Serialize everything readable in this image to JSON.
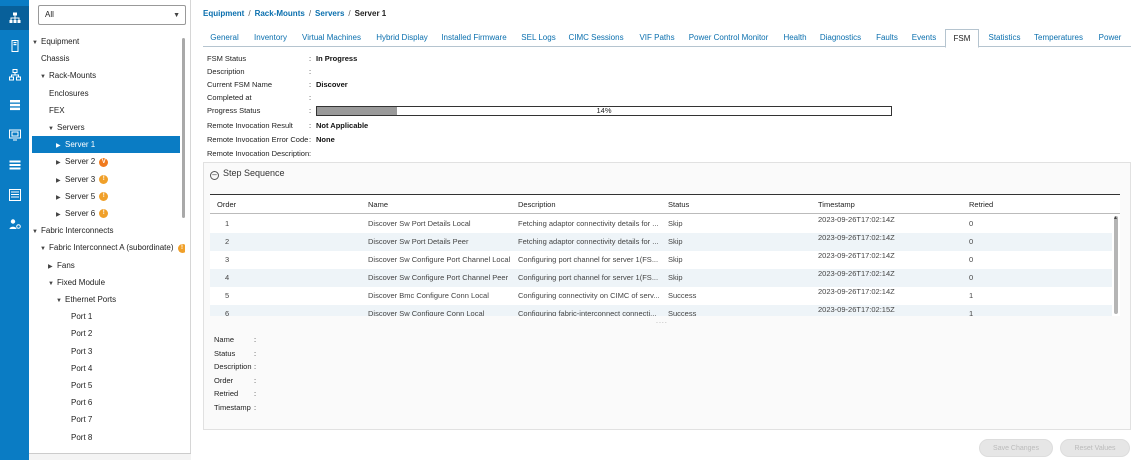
{
  "rail": {
    "items": [
      {
        "icon": "network-topology-icon",
        "active": true
      },
      {
        "icon": "server-icon",
        "active": false
      },
      {
        "icon": "lan-icon",
        "active": false
      },
      {
        "icon": "san-storage-icon",
        "active": false
      },
      {
        "icon": "vm-icon",
        "active": false
      },
      {
        "icon": "storage-stack-icon",
        "active": false
      },
      {
        "icon": "admin-list-icon",
        "active": false
      },
      {
        "icon": "user-settings-icon",
        "active": false
      }
    ]
  },
  "nav": {
    "filter_value": "All",
    "tree": [
      {
        "label": "Equipment",
        "depth": 0,
        "expander": "down"
      },
      {
        "label": "Chassis",
        "depth": 1,
        "expander": "none"
      },
      {
        "label": "Rack-Mounts",
        "depth": 1,
        "expander": "down"
      },
      {
        "label": "Enclosures",
        "depth": 2,
        "expander": "none"
      },
      {
        "label": "FEX",
        "depth": 2,
        "expander": "none"
      },
      {
        "label": "Servers",
        "depth": 2,
        "expander": "down"
      },
      {
        "label": "Server 1",
        "depth": 3,
        "expander": "right",
        "selected": true
      },
      {
        "label": "Server 2",
        "depth": 3,
        "expander": "right",
        "badge": "V",
        "badge_kind": "major"
      },
      {
        "label": "Server 3",
        "depth": 3,
        "expander": "right",
        "badge": "!",
        "badge_kind": "minor"
      },
      {
        "label": "Server 5",
        "depth": 3,
        "expander": "right",
        "badge": "!",
        "badge_kind": "minor"
      },
      {
        "label": "Server 6",
        "depth": 3,
        "expander": "right",
        "badge": "!",
        "badge_kind": "minor"
      },
      {
        "label": "Fabric Interconnects",
        "depth": 0,
        "expander": "down"
      },
      {
        "label": "Fabric Interconnect A (subordinate)",
        "depth": 1,
        "expander": "down",
        "badge": "!",
        "badge_kind": "minor"
      },
      {
        "label": "Fans",
        "depth": 2,
        "expander": "right"
      },
      {
        "label": "Fixed Module",
        "depth": 2,
        "expander": "down"
      },
      {
        "label": "Ethernet Ports",
        "depth": 3,
        "expander": "down"
      },
      {
        "label": "Port 1",
        "depth": 4,
        "expander": "none"
      },
      {
        "label": "Port 2",
        "depth": 4,
        "expander": "none"
      },
      {
        "label": "Port 3",
        "depth": 4,
        "expander": "none"
      },
      {
        "label": "Port 4",
        "depth": 4,
        "expander": "none"
      },
      {
        "label": "Port 5",
        "depth": 4,
        "expander": "none"
      },
      {
        "label": "Port 6",
        "depth": 4,
        "expander": "none"
      },
      {
        "label": "Port 7",
        "depth": 4,
        "expander": "none"
      },
      {
        "label": "Port 8",
        "depth": 4,
        "expander": "none"
      }
    ]
  },
  "breadcrumb": {
    "items": [
      "Equipment",
      "Rack-Mounts",
      "Servers"
    ],
    "current": "Server 1"
  },
  "tabs": [
    {
      "label": "General"
    },
    {
      "label": "Inventory"
    },
    {
      "label": "Virtual Machines"
    },
    {
      "label": "Hybrid Display"
    },
    {
      "label": "Installed Firmware"
    },
    {
      "label": "SEL Logs"
    },
    {
      "label": "CIMC Sessions"
    },
    {
      "label": "VIF Paths"
    },
    {
      "label": "Power Control Monitor"
    },
    {
      "label": "Health"
    },
    {
      "label": "Diagnostics"
    },
    {
      "label": "Faults"
    },
    {
      "label": "Events"
    },
    {
      "label": "FSM",
      "active": true
    },
    {
      "label": "Statistics"
    },
    {
      "label": "Temperatures"
    },
    {
      "label": "Power"
    }
  ],
  "fsm": {
    "status_label": "FSM Status",
    "status_value": "In Progress",
    "description_label": "Description",
    "description_value": "",
    "current_name_label": "Current FSM Name",
    "current_name_value": "Discover",
    "completed_label": "Completed at",
    "completed_value": "",
    "progress_label": "Progress Status",
    "progress_percent": 14,
    "progress_text": "14%",
    "remote_result_label": "Remote Invocation Result",
    "remote_result_value": "Not Applicable",
    "remote_error_label": "Remote Invocation Error Code",
    "remote_error_value": "None",
    "remote_desc_label": "Remote Invocation Description",
    "remote_desc_value": ""
  },
  "step_sequence": {
    "title": "Step Sequence",
    "columns": [
      "Order",
      "Name",
      "Description",
      "Status",
      "Timestamp",
      "Retried"
    ],
    "rows": [
      {
        "order": "1",
        "name": "Discover Sw Port Details Local",
        "description": "Fetching adaptor connectivity details for ...",
        "status": "Skip",
        "timestamp": "2023-09-26T17:02:14Z",
        "retried": "0"
      },
      {
        "order": "2",
        "name": "Discover Sw Port Details Peer",
        "description": "Fetching adaptor connectivity details for ...",
        "status": "Skip",
        "timestamp": "2023-09-26T17:02:14Z",
        "retried": "0"
      },
      {
        "order": "3",
        "name": "Discover Sw Configure Port Channel Local",
        "description": "Configuring port channel for server 1(FS...",
        "status": "Skip",
        "timestamp": "2023-09-26T17:02:14Z",
        "retried": "0"
      },
      {
        "order": "4",
        "name": "Discover Sw Configure Port Channel Peer",
        "description": "Configuring port channel for server 1(FS...",
        "status": "Skip",
        "timestamp": "2023-09-26T17:02:14Z",
        "retried": "0"
      },
      {
        "order": "5",
        "name": "Discover Bmc Configure Conn Local",
        "description": "Configuring connectivity on CIMC of serv...",
        "status": "Success",
        "timestamp": "2023-09-26T17:02:14Z",
        "retried": "1"
      },
      {
        "order": "6",
        "name": "Discover Sw Configure Conn Local",
        "description": "Configuring fabric-interconnect connecti...",
        "status": "Success",
        "timestamp": "2023-09-26T17:02:15Z",
        "retried": "1"
      }
    ],
    "splitter": "....",
    "detail": [
      {
        "label": "Name",
        "value": ""
      },
      {
        "label": "Status",
        "value": ""
      },
      {
        "label": "Description",
        "value": ""
      },
      {
        "label": "Order",
        "value": ""
      },
      {
        "label": "Retried",
        "value": ""
      },
      {
        "label": "Timestamp",
        "value": ""
      }
    ]
  },
  "footer": {
    "save_label": "Save Changes",
    "reset_label": "Reset Values"
  }
}
